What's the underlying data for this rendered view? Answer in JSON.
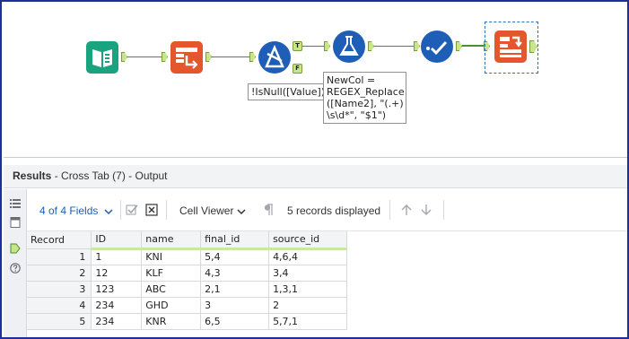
{
  "workflow": {
    "tools": [
      {
        "name": "input-data",
        "color": "#1aa37f"
      },
      {
        "name": "cross-tab",
        "color": "#e4572e"
      },
      {
        "name": "filter",
        "color": "#1f5eb6"
      },
      {
        "name": "formula",
        "color": "#1f5eb6"
      },
      {
        "name": "select",
        "color": "#1f5eb6"
      },
      {
        "name": "cross-tab-selected",
        "color": "#e4572e"
      }
    ],
    "filter_true_label": "T",
    "filter_false_label": "F",
    "filter_annotation": "!IsNull([Value])",
    "formula_annotation": "NewCol =\nREGEX_Replace\n([Name2], \"(.+)\n\\s\\d*\", \"$1\")"
  },
  "results": {
    "title_bold": "Results",
    "title_rest": " - Cross Tab (7) - Output",
    "fields_label": "4 of 4 Fields",
    "viewer_label": "Cell Viewer",
    "records_label": "5 records displayed"
  },
  "table": {
    "columns": [
      "Record",
      "ID",
      "name",
      "final_id",
      "source_id"
    ],
    "rows": [
      [
        "1",
        "1",
        "KNI",
        "5,4",
        "4,6,4"
      ],
      [
        "2",
        "12",
        "KLF",
        "4,3",
        "3,4"
      ],
      [
        "3",
        "123",
        "ABC",
        "2,1",
        "1,3,1"
      ],
      [
        "4",
        "234",
        "GHD",
        "3",
        "2"
      ],
      [
        "5",
        "234",
        "KNR",
        "6,5",
        "5,7,1"
      ]
    ]
  },
  "colors": {
    "frame": "#1f2f9a",
    "accent_green": "#c7e68a",
    "link_blue": "#1f5eb6"
  }
}
